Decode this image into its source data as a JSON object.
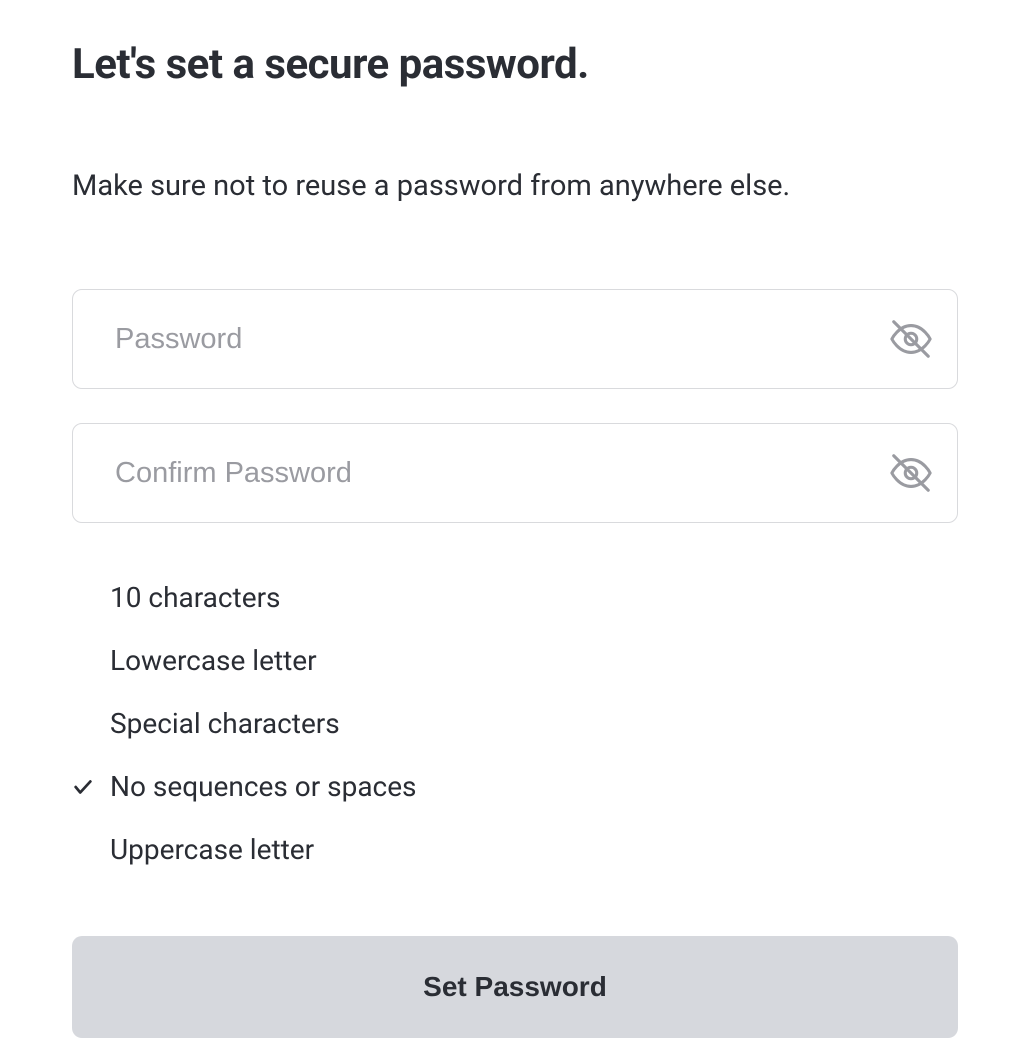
{
  "heading": "Let's set a secure password.",
  "subheading": "Make sure not to reuse a password from anywhere else.",
  "fields": {
    "password": {
      "placeholder": "Password",
      "value": ""
    },
    "confirm": {
      "placeholder": "Confirm Password",
      "value": ""
    }
  },
  "requirements": [
    {
      "label": "10 characters",
      "met": false
    },
    {
      "label": "Lowercase letter",
      "met": false
    },
    {
      "label": "Special characters",
      "met": false
    },
    {
      "label": "No sequences or spaces",
      "met": true
    },
    {
      "label": "Uppercase letter",
      "met": false
    }
  ],
  "submit_label": "Set Password"
}
